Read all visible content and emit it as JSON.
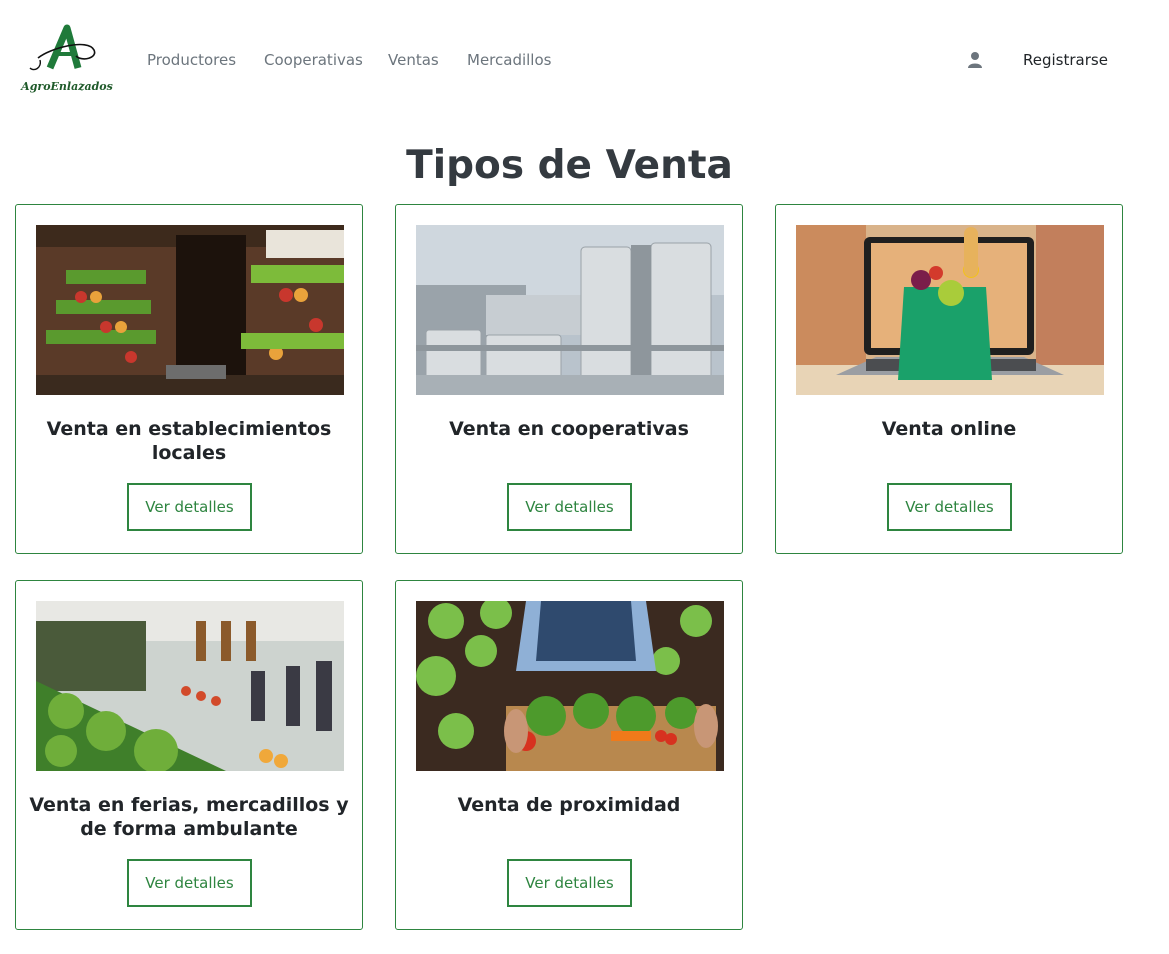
{
  "brand": {
    "logo_text": "AgroEnlazados"
  },
  "nav": {
    "items": [
      {
        "label": "Productores"
      },
      {
        "label": "Cooperativas"
      },
      {
        "label": "Ventas"
      },
      {
        "label": "Mercadillos"
      }
    ],
    "register_label": "Registrarse"
  },
  "page": {
    "title": "Tipos de Venta"
  },
  "cards": [
    {
      "title": "Venta en establecimientos locales",
      "button": "Ver detalles"
    },
    {
      "title": "Venta en cooperativas",
      "button": "Ver detalles"
    },
    {
      "title": "Venta online",
      "button": "Ver detalles"
    },
    {
      "title": "Venta en ferias, mercadillos y de forma ambulante",
      "button": "Ver detalles"
    },
    {
      "title": "Venta de proximidad",
      "button": "Ver detalles"
    }
  ],
  "colors": {
    "accent": "#2e8540",
    "nav_text": "#6c757d",
    "title": "#343a40"
  }
}
